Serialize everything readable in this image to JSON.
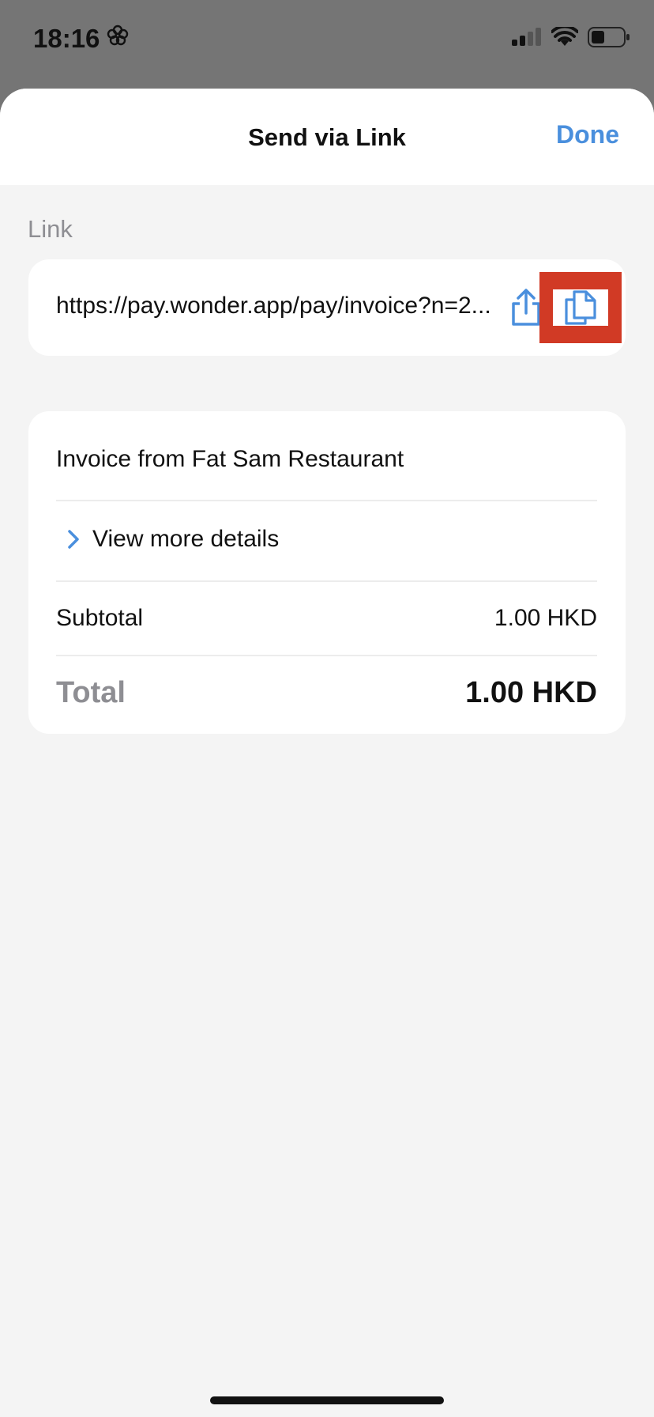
{
  "status_bar": {
    "time": "18:16"
  },
  "header": {
    "title": "Send via Link",
    "done_label": "Done"
  },
  "link_section": {
    "label": "Link",
    "url": "https://pay.wonder.app/pay/invoice?n=2..."
  },
  "invoice": {
    "title": "Invoice from Fat Sam Restaurant",
    "details_label": "View more details",
    "subtotal_label": "Subtotal",
    "subtotal_value": "1.00 HKD",
    "total_label": "Total",
    "total_value": "1.00 HKD"
  },
  "colors": {
    "accent": "#4a8fdd",
    "highlight": "#d13a25",
    "background": "#f4f4f4"
  }
}
